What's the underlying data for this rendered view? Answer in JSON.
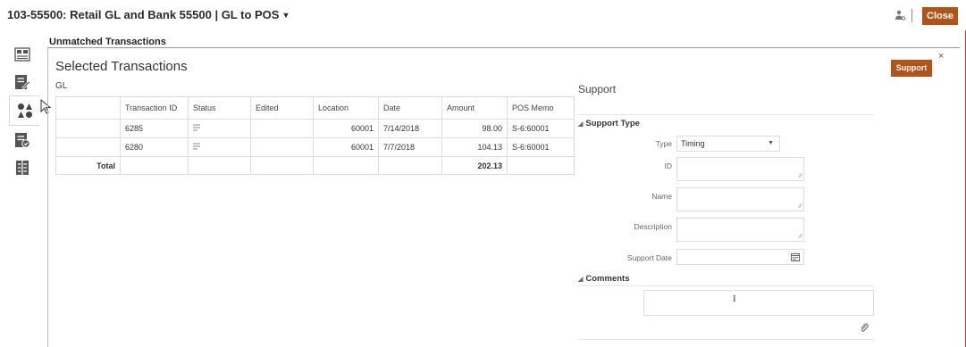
{
  "header": {
    "title": "103-55500: Retail GL and Bank 55500 | GL to POS",
    "close_label": "Close",
    "icons": [
      "user-settings-icon"
    ]
  },
  "left_rail": {
    "items": [
      "summary-icon",
      "edit-list-icon",
      "shapes-icon",
      "approve-list-icon",
      "columns-icon"
    ],
    "active_index": 2
  },
  "main": {
    "section_title": "Unmatched Transactions",
    "dialog_title": "Selected Transactions",
    "support_button_label": "Support",
    "close_x": "×"
  },
  "gl": {
    "label": "GL",
    "columns": [
      "Transaction ID",
      "Status",
      "Edited",
      "Location",
      "Date",
      "Amount",
      "POS Memo"
    ],
    "rows": [
      {
        "transaction_id": "6285",
        "status_icon": "note-icon",
        "edited": "",
        "location": "60001",
        "date": "7/14/2018",
        "amount": "98.00",
        "pos_memo": "S-6:60001"
      },
      {
        "transaction_id": "6280",
        "status_icon": "note-icon",
        "edited": "",
        "location": "60001",
        "date": "7/7/2018",
        "amount": "104.13",
        "pos_memo": "S-6:60001"
      }
    ],
    "total_label": "Total",
    "total_amount": "202.13"
  },
  "support": {
    "title": "Support",
    "type_group": "Support Type",
    "type_label": "Type",
    "type_value": "Timing",
    "id_label": "ID",
    "name_label": "Name",
    "description_label": "Description",
    "date_label": "Support Date",
    "comments_group": "Comments"
  },
  "colors": {
    "accent": "#b2541a",
    "border": "#d7323a"
  }
}
